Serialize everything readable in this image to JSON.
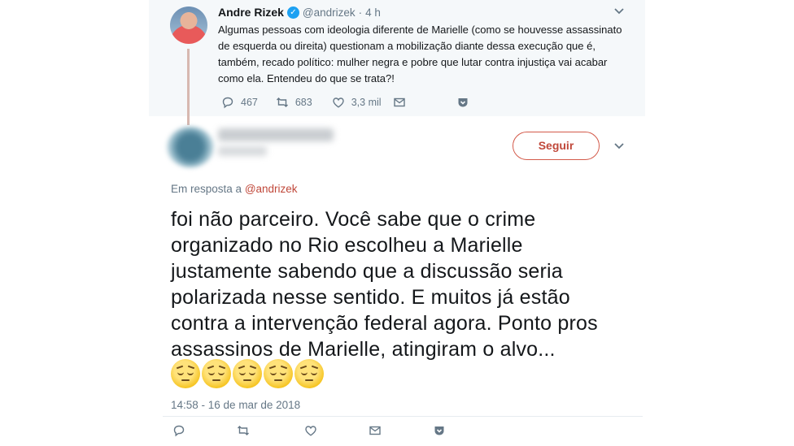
{
  "parent_tweet": {
    "author_name": "Andre Rizek",
    "author_handle": "@andrizek",
    "separator": "·",
    "time_ago": "4 h",
    "text": "Algumas pessoas com ideologia diferente de Marielle (como se houvesse assassinato de esquerda ou direita) questionam a mobilização diante dessa execução que é, também, recado político: mulher negra e pobre que lutar contra injustiça vai acabar como ela. Entendeu do que se trata?!",
    "reply_count": "467",
    "retweet_count": "683",
    "like_count": "3,3 mil"
  },
  "main_tweet": {
    "follow_label": "Seguir",
    "reply_prefix": "Em resposta a",
    "reply_mention": "@andrizek",
    "text": "foi não parceiro. Você sabe que o crime organizado no Rio escolheu a Marielle justamente sabendo que a discussão seria polarizada nesse sentido. E muitos já estão contra a intervenção federal agora. Ponto pros assassinos de Marielle, atingiram o alvo...",
    "emoji_count": 5,
    "emoji_name": "pensive-face",
    "timestamp": "14:58 - 16 de mar de 2018"
  },
  "icons": [
    "reply-icon",
    "retweet-icon",
    "like-icon",
    "direct-message-icon",
    "save-icon",
    "chevron-down-icon",
    "verified-badge-icon"
  ],
  "colors": {
    "accent": "#c0483a",
    "secondary_text": "#657786",
    "parent_background": "#f5f8fa",
    "verified": "#1da1f2"
  }
}
